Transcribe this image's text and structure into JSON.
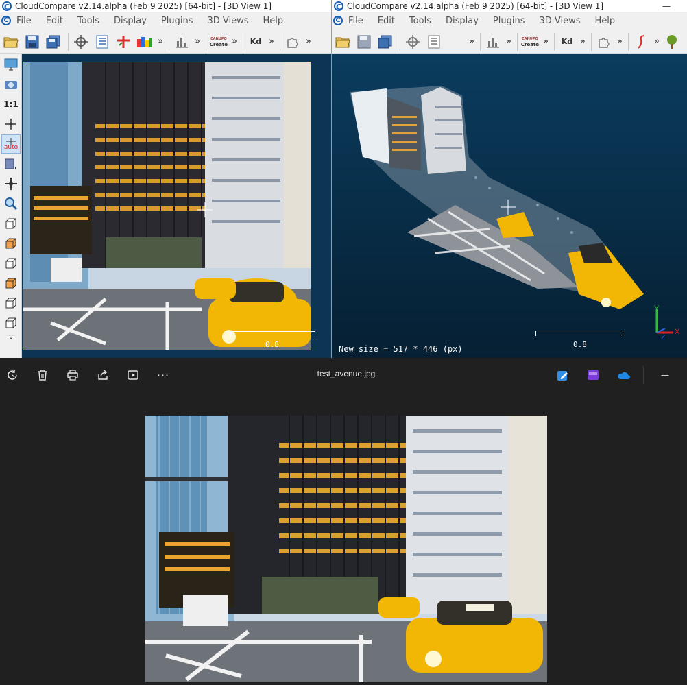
{
  "left_window": {
    "title": "CloudCompare v2.14.alpha (Feb  9 2025) [64-bit] - [3D View 1]",
    "menu": [
      "File",
      "Edit",
      "Tools",
      "Display",
      "Plugins",
      "3D Views",
      "Help"
    ],
    "toolbar_labels": {
      "canupo_top": "CANUPO",
      "canupo_bottom": "Create",
      "kd": "Kd"
    },
    "vertical_toolbar": {
      "one_to_one": "1:1",
      "auto": "auto"
    },
    "scale_label": "0.8"
  },
  "right_window": {
    "title": "CloudCompare v2.14.alpha (Feb  9 2025) [64-bit] - [3D View 1]",
    "minimize": "—",
    "menu": [
      "File",
      "Edit",
      "Tools",
      "Display",
      "Plugins",
      "3D Views",
      "Help"
    ],
    "toolbar_labels": {
      "canupo_top": "CANUPO",
      "canupo_bottom": "Create",
      "kd": "Kd"
    },
    "status_message": "New size = 517 * 446 (px)",
    "scale_label": "0.8",
    "axis": {
      "x": "X",
      "y": "Y",
      "z": "Z"
    }
  },
  "photos": {
    "filename": "test_avenue.jpg",
    "more_label": "···",
    "minimize": "—"
  },
  "colors": {
    "cc_accent": "#1a5fb4",
    "view_background": "#0b3552",
    "photos_background": "#202020",
    "taxi_yellow": "#f2b705",
    "selection_frame": "#e6e600"
  }
}
